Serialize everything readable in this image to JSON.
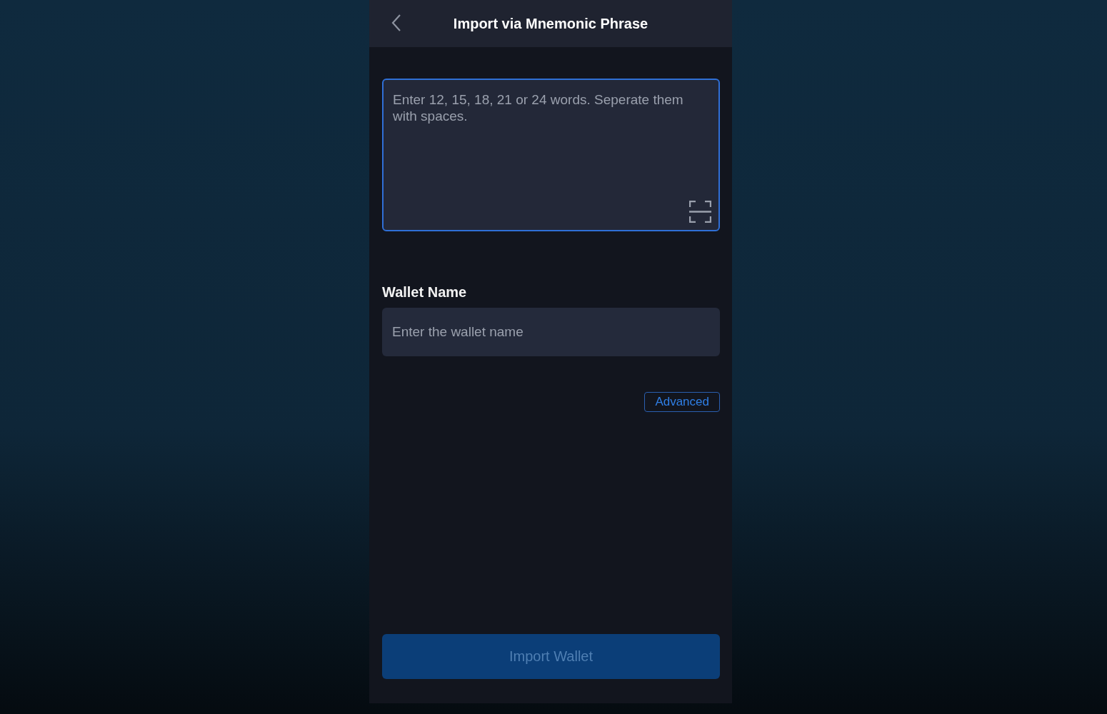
{
  "header": {
    "title": "Import via Mnemonic Phrase"
  },
  "mnemonic_field": {
    "placeholder": "Enter 12, 15, 18, 21 or 24 words. Seperate them with spaces.",
    "focused": true
  },
  "wallet_name": {
    "label": "Wallet Name",
    "placeholder": "Enter the wallet name"
  },
  "advanced_button": {
    "label": "Advanced"
  },
  "import_button": {
    "label": "Import Wallet",
    "disabled": true
  }
}
